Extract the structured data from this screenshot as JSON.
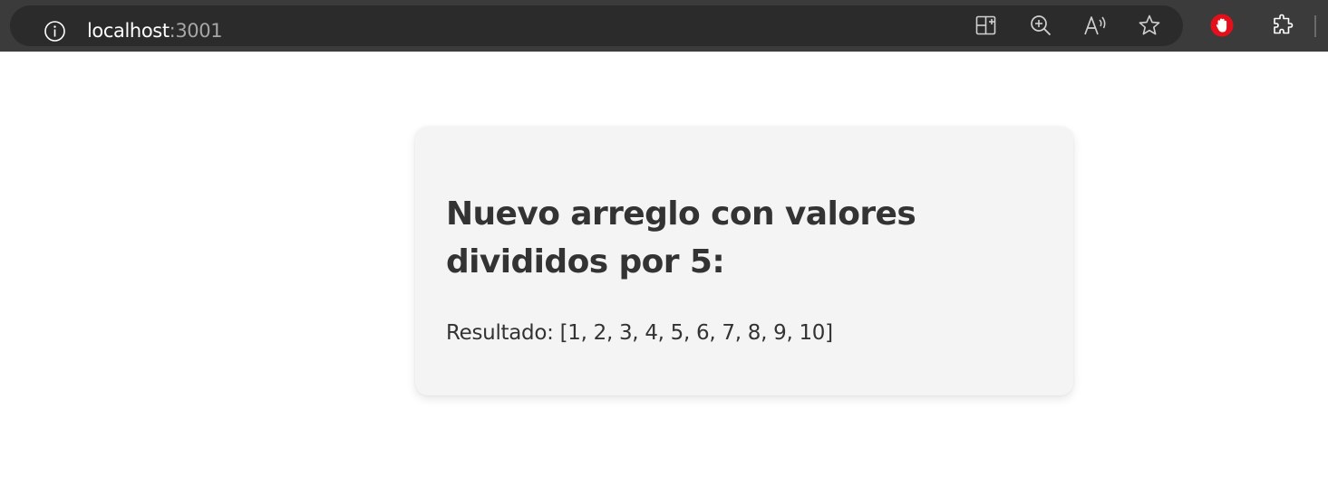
{
  "browser": {
    "url_host": "localhost",
    "url_port": ":3001",
    "icons": [
      "info-icon",
      "split-screen-icon",
      "zoom-icon",
      "read-aloud-icon",
      "favorite-star-icon",
      "ad-blocker-icon",
      "extensions-icon"
    ],
    "colors": {
      "toolbar_bg": "#3b3b3b",
      "address_bar_bg": "#2b2b2b",
      "ad_blocker": "#e3101b"
    }
  },
  "page": {
    "title": "Nuevo arreglo con valores divididos por 5:",
    "result": "Resultado: [1, 2, 3, 4, 5, 6, 7, 8, 9, 10]",
    "colors": {
      "card_bg": "#f4f4f4",
      "text": "#333333"
    }
  }
}
